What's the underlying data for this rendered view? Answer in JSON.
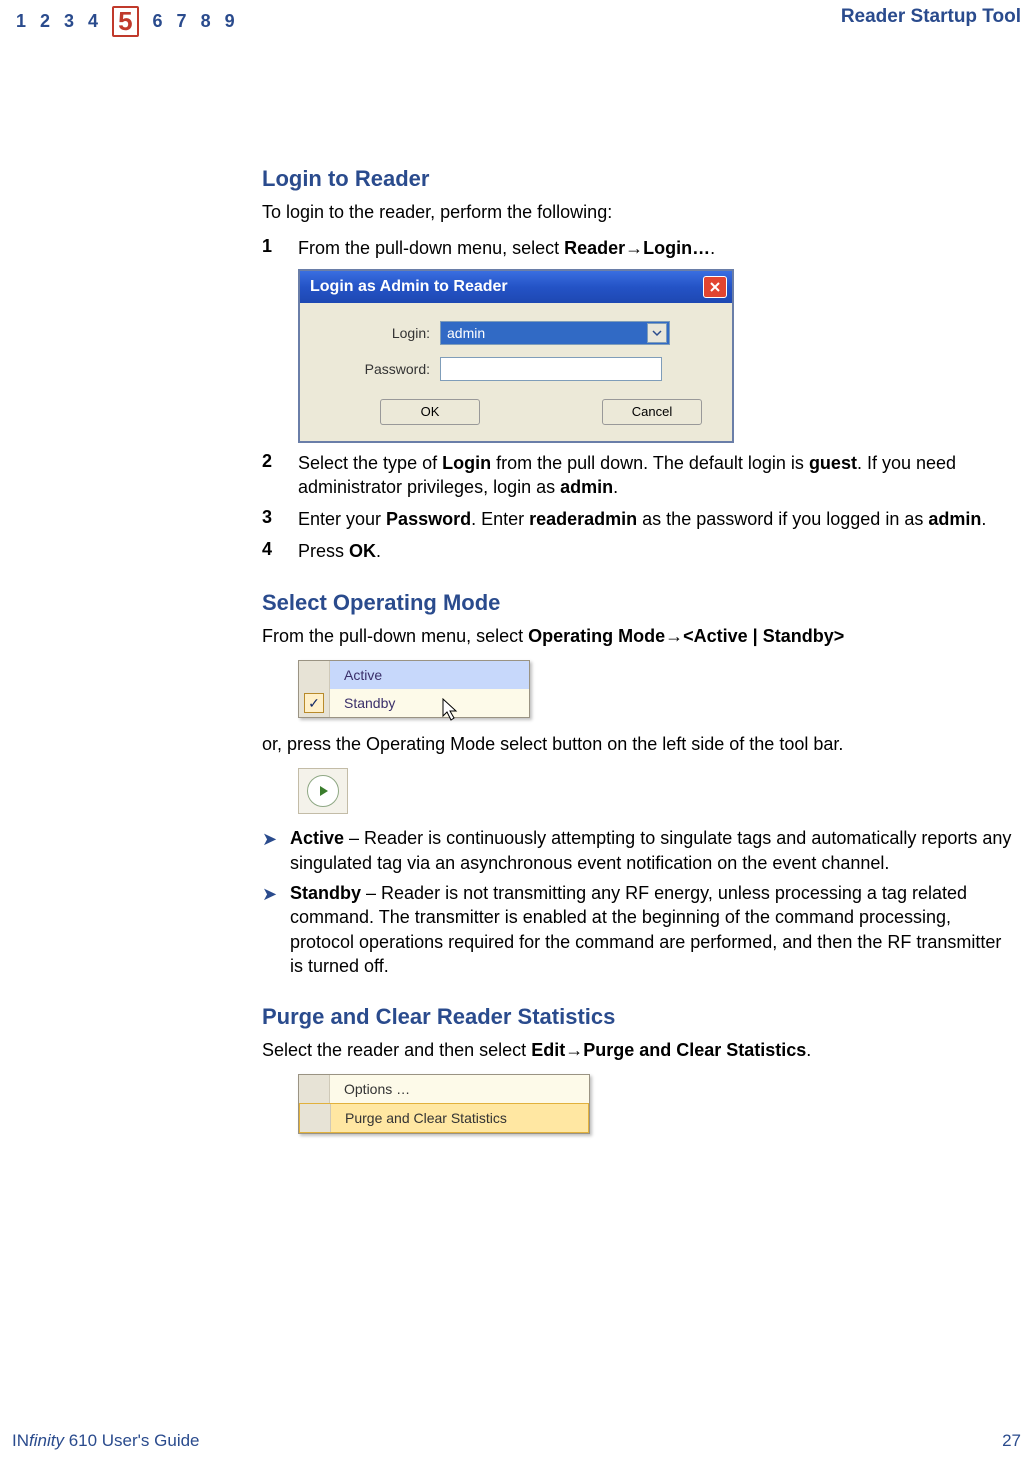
{
  "header": {
    "chapters": [
      "1",
      "2",
      "3",
      "4",
      "5",
      "6",
      "7",
      "8",
      "9"
    ],
    "current_index": 4,
    "title": "Reader Startup Tool"
  },
  "section_login": {
    "heading": "Login to Reader",
    "intro": "To login to the reader, perform the following:",
    "step1": {
      "num": "1",
      "prefix": "From the pull-down menu, select ",
      "menu1": "Reader",
      "menu2": "Login…",
      "suffix": "."
    },
    "dialog": {
      "title": "Login as Admin to Reader",
      "login_label": "Login:",
      "login_value": "admin",
      "password_label": "Password:",
      "ok": "OK",
      "cancel": "Cancel"
    },
    "step2": {
      "num": "2",
      "t1": "Select the type of ",
      "b1": "Login",
      "t2": " from the pull down. The default login is ",
      "b2": "guest",
      "t3": ". If you need administrator privileges, login as ",
      "b3": "admin",
      "t4": "."
    },
    "step3": {
      "num": "3",
      "t1": "Enter your ",
      "b1": "Password",
      "t2": ". Enter ",
      "b2": "readeradmin",
      "t3": " as the password if you logged in as ",
      "b3": "admin",
      "t4": "."
    },
    "step4": {
      "num": "4",
      "t1": "Press ",
      "b1": "OK",
      "t2": "."
    }
  },
  "section_mode": {
    "heading": "Select Operating Mode",
    "intro_prefix": "From the pull-down menu, select ",
    "intro_menu1": "Operating Mode",
    "intro_menu2": "<Active | Standby>",
    "menu_items": {
      "active": "Active",
      "standby": "Standby"
    },
    "after_menu": "or, press the Operating Mode select button on the left side of the tool bar.",
    "bullet_active": {
      "label": "Active",
      "text": " – Reader is continuously attempting to singulate tags and automatically reports any singulated tag via an asynchronous event notification on the event channel."
    },
    "bullet_standby": {
      "label": "Standby",
      "text": " – Reader is not transmitting any RF energy, unless processing a tag related command. The transmitter is enabled at the beginning of the command processing, protocol operations required for the command are performed, and then the RF transmitter is turned off."
    }
  },
  "section_purge": {
    "heading": "Purge and Clear Reader Statistics",
    "intro_prefix": "Select the reader and then select ",
    "menu1": "Edit",
    "menu2": "Purge and Clear Statistics",
    "suffix": ".",
    "menu_items": {
      "options": "Options …",
      "purge": "Purge and Clear Statistics"
    }
  },
  "footer": {
    "left_prefix": "IN",
    "left_italic": "finity",
    "left_rest": " 610 User's Guide",
    "page": "27"
  }
}
